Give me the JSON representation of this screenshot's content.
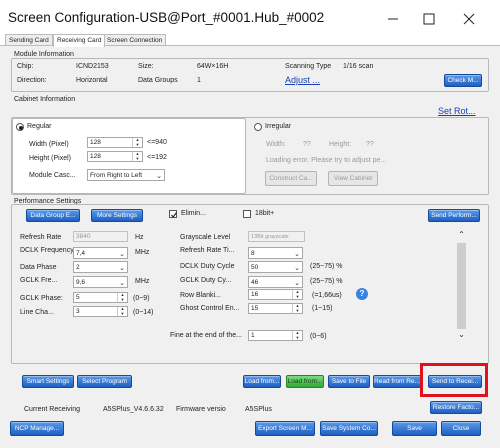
{
  "window": {
    "title": "Screen Configuration-USB@Port_#0001.Hub_#0002"
  },
  "tabs": [
    {
      "label": "Sending Card"
    },
    {
      "label": "Receiving Card"
    },
    {
      "label": "Screen Connection"
    }
  ],
  "module_info": {
    "group_label": "Module Information",
    "chip_label": "Chip:",
    "chip_value": "ICND2153",
    "size_label": "Size:",
    "size_value": "64W×16H",
    "scan_label": "Scanning Type",
    "scan_value": "1/16 scan",
    "direction_label": "Direction:",
    "direction_value": "Horizontal",
    "groups_label": "Data Groups",
    "groups_value": "1",
    "adjust_link": "Adjust ...",
    "check_button": "Check M..."
  },
  "cabinet_info": {
    "group_label": "Cabinet Information",
    "set_link": "Set Rot...",
    "regular_label": "Regular",
    "width_label": "Width (Pixel)",
    "width_value": "128",
    "width_limit": "<=940",
    "height_label": "Height (Pixel)",
    "height_value": "128",
    "height_limit": "<=192",
    "cascade_label": "Module Casc...",
    "cascade_value": "From Right to Left",
    "irregular_label": "Irregular",
    "irr_width_label": "Width:",
    "irr_width_value": "??",
    "irr_height_label": "Height:",
    "irr_height_value": "??",
    "loading_text": "Loading error. Please try to adjust pe...",
    "construct_button": "Construct Ca...",
    "view_button": "View Cabinet"
  },
  "performance": {
    "group_label": "Performance Settings",
    "data_group_button": "Data Group E...",
    "more_settings_button": "More Settings",
    "elimin_label": "Elimin...",
    "bit18_label": "18bit+",
    "send_perform_button": "Send Perform...",
    "refresh_rate_label": "Refresh Rate",
    "refresh_rate_value": "3840",
    "refresh_rate_unit": "Hz",
    "dclk_label": "DCLK Frequency",
    "dclk_value": "7,4",
    "dclk_unit": "MHz",
    "data_phase_label": "Data Phase",
    "data_phase_value": "2",
    "gclk_freq_label": "GCLK Fre...",
    "gclk_freq_value": "9,6",
    "gclk_freq_unit": "MHz",
    "gclk_phase_label": "GCLK Phase:",
    "gclk_phase_value": "5",
    "gclk_phase_range": "(0~9)",
    "line_change_label": "Line Cha...",
    "line_change_value": "3",
    "line_change_range": "(0~14)",
    "grayscale_label": "Grayscale Level",
    "grayscale_value": "13Bit grayscale",
    "refresh_times_label": "Refresh Rate Ti...",
    "refresh_times_value": "8",
    "dclk_duty_label": "DCLK Duty Cycle",
    "dclk_duty_value": "50",
    "dclk_duty_range": "(25~75) %",
    "gclk_duty_label": "GCLK Duty Cy...",
    "gclk_duty_value": "46",
    "gclk_duty_range": "(25~75) %",
    "row_blank_label": "Row Blanki...",
    "row_blank_value": "16",
    "row_blank_range": "(=1,66us)",
    "ghost_label": "Ghost Control En...",
    "ghost_value": "15",
    "ghost_range": "(1~15)",
    "fine_label": "Fine at the end of the...",
    "fine_value": "1",
    "fine_range": "(0~6)"
  },
  "actions": {
    "smart_settings": "Smart Settings",
    "select_program": "Select Program",
    "load_from_1": "Load from...",
    "load_from_2": "Load from...",
    "save_to_file": "Save to File",
    "read_from": "Read from Re...",
    "send_to": "Send to Recei..."
  },
  "status": {
    "current_label": "Current Receiving",
    "current_value": "A5SPlus_V4.6.6.32",
    "firmware_label": "Firmware versio",
    "firmware_value": "A5SPlus",
    "restore_button": "Restore Facto..."
  },
  "footer": {
    "ncp_manage": "NCP Manage...",
    "export_screen": "Export Screen M...",
    "save_system": "Save System Co...",
    "save": "Save",
    "close": "Close"
  },
  "colors": {
    "highlight_border": "#e0101c",
    "button_blue": "#1f5fc2",
    "button_green": "#2fa838",
    "link": "#1a3fb4"
  }
}
